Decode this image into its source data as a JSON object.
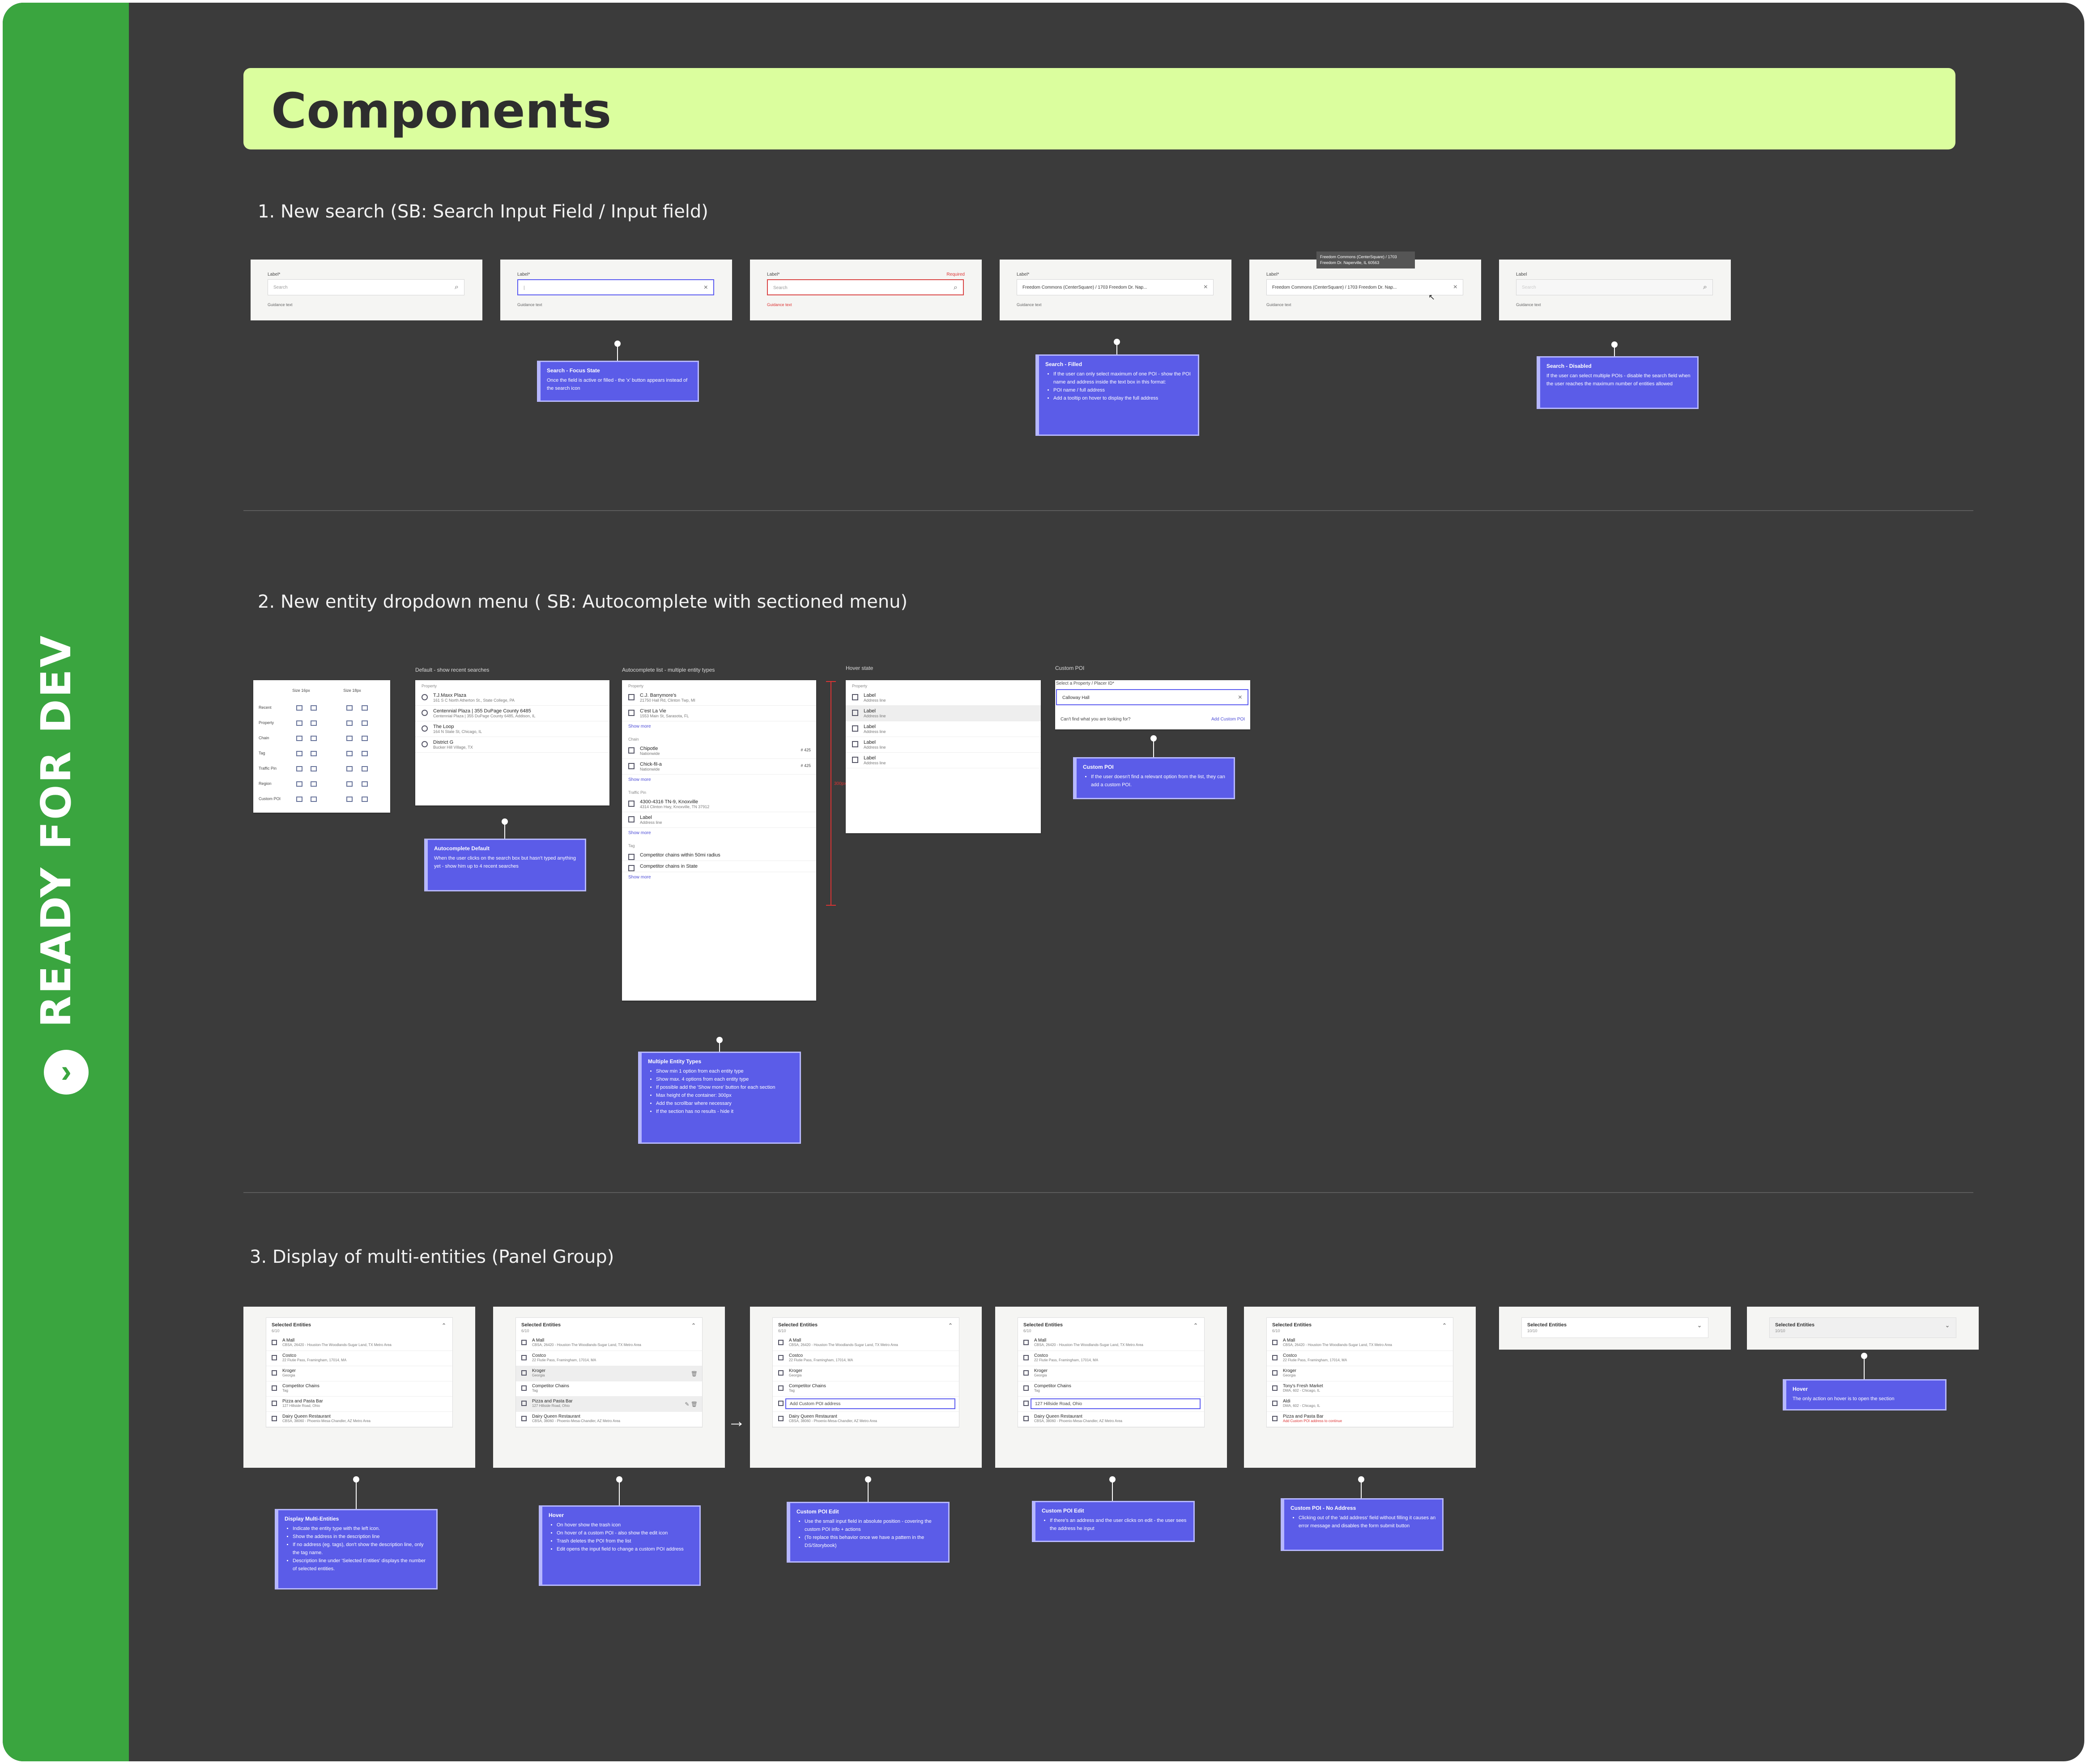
{
  "rail": {
    "label": "READY FOR DEV",
    "arrow": "›"
  },
  "header": {
    "title": "Components"
  },
  "s1": {
    "title": "1. New search (SB: Search Input Field / Input field)",
    "cards": [
      {
        "label": "Label*",
        "value": "Search",
        "guide": "Guidance text",
        "state": "default",
        "icon": "⌕"
      },
      {
        "label": "Label*",
        "value": "|",
        "guide": "Guidance text",
        "state": "focus",
        "icon": "×"
      },
      {
        "label": "Label*",
        "required": "Required",
        "value": "Search",
        "guide": "Guidance text",
        "state": "error",
        "icon": "⌕"
      },
      {
        "label": "Label*",
        "value": "Freedom Commons (CenterSquare) / 1703 Freedom Dr. Nap...",
        "guide": "Guidance text",
        "state": "filled",
        "icon": "×"
      },
      {
        "label": "Label*",
        "value": "Freedom Commons (CenterSquare) / 1703 Freedom Dr. Nap...",
        "guide": "Guidance text",
        "state": "filled",
        "icon": "×",
        "tooltip": "Freedom Commons (CenterSquare) / 1703 Freedom Dr. Naperville, IL 60563"
      },
      {
        "label": "Label",
        "value": "Search",
        "guide": "Guidance text",
        "state": "disabled",
        "icon": "⌕"
      }
    ],
    "notes": {
      "focus": {
        "title": "Search - Focus State",
        "body": "Once the field is active or filled - the 'x' button appears instead of the search icon"
      },
      "filled": {
        "title": "Search - Filled",
        "items": [
          "If the user can only select maximum of one POI - show the POI name and address inside the text box in this format:",
          "POI name / full address",
          "Add a tooltip on hover to display the full address"
        ]
      },
      "disabled": {
        "title": "Search - Disabled",
        "body": "If the user can select multiple POIs - disable the search field when the user reaches the maximum number of entities allowed"
      }
    }
  },
  "s2": {
    "title": "2. New entity dropdown menu ( SB: Autocomplete with sectioned menu)",
    "legend": {
      "heads": [
        "Size 16px",
        "Size 18px"
      ],
      "rows": [
        "Recent",
        "Property",
        "Chain",
        "Tag",
        "Traffic Pin",
        "Region",
        "Custom POI"
      ]
    },
    "recent": {
      "title": "Default - show recent searches",
      "group": "Property",
      "items": [
        {
          "name": "T.J.Maxx Plaza",
          "addr": "161 S C North Atherton St., State College, PA"
        },
        {
          "name": "Centennial Plaza | 355 DuPage County 6485",
          "addr": "Centennial Plaza | 355 DuPage County 6485, Addison, IL"
        },
        {
          "name": "The Loop",
          "addr": "164 N State St, Chicago, IL"
        },
        {
          "name": "District G",
          "addr": "Bucker Hill Village, TX"
        }
      ],
      "note": {
        "title": "Autocomplete Default",
        "body": "When the user clicks on the search box but hasn't typed anything yet - show him up to 4 recent searches"
      }
    },
    "multi": {
      "title": "Autocomplete list - multiple entity types",
      "groups": [
        {
          "name": "Property",
          "items": [
            {
              "name": "C.J. Barrymore's",
              "addr": "21750 Hall Rd, Clinton Twp, MI"
            },
            {
              "name": "C'est La Vie",
              "addr": "1553 Main St, Sarasota, FL"
            }
          ],
          "more": "Show more"
        },
        {
          "name": "Chain",
          "items": [
            {
              "name": "Chipotle",
              "addr": "Nationwide",
              "badge": "# 425"
            },
            {
              "name": "Chick-fil-a",
              "addr": "Nationwide",
              "badge": "# 425"
            }
          ],
          "more": "Show more"
        },
        {
          "name": "Traffic Pin",
          "items": [
            {
              "name": "4300-4316 TN-9, Knoxville",
              "addr": "4314 Clinton Hwy, Knoxville, TN 37912"
            },
            {
              "name": "Label",
              "addr": "Address line"
            }
          ],
          "more": "Show more"
        },
        {
          "name": "Tag",
          "items": [
            {
              "name": "Competitor chains within 50mi radius",
              "addr": ""
            },
            {
              "name": "Competitor chains in State",
              "addr": ""
            }
          ],
          "more": "Show more"
        }
      ],
      "height_label": "300px",
      "note": {
        "title": "Multiple Entity Types",
        "items": [
          "Show min 1 option from each entity type",
          "Show max. 4 options from each entity type",
          "If possible add the 'Show more' button for each section",
          "Max height of the container: 300px",
          "Add the scrollbar where necessary",
          "If the section has no results - hide it"
        ]
      }
    },
    "hover": {
      "title": "Hover state",
      "group": "Property",
      "items": [
        {
          "name": "Label",
          "addr": "Address line"
        },
        {
          "name": "Label",
          "addr": "Address line"
        },
        {
          "name": "Label",
          "addr": "Address line"
        },
        {
          "name": "Label",
          "addr": "Address line"
        },
        {
          "name": "Label",
          "addr": "Address line"
        }
      ]
    },
    "custom": {
      "title": "Custom POI",
      "label": "Select a Property / Placer ID*",
      "value": "Calloway Hall",
      "prompt": "Can't find what you are looking for?",
      "link": "Add Custom POI",
      "note": {
        "title": "Custom POI",
        "items": [
          "If the user doesn't find a relevant option from the list, they can add a custom POI."
        ]
      }
    }
  },
  "s3": {
    "title": "3. Display of multi-entities (Panel Group)",
    "header": "Selected Entities",
    "count": "6/10",
    "count_full": "10/10",
    "entities": [
      {
        "name": "A Mall",
        "addr": "CBSA, 26420 - Houston-The Woodlands-Sugar Land, TX Metro Area"
      },
      {
        "name": "Costco",
        "addr": "22 Flutie Pass, Framingham, 17014, MA"
      },
      {
        "name": "Kroger",
        "addr": "Georgia"
      },
      {
        "name": "Competitor Chains",
        "addr": "Tag"
      },
      {
        "name": "Pizza and Pasta Bar",
        "addr": "127 Hillside Road, Ohio"
      },
      {
        "name": "Dairy Queen Restaurant",
        "addr": "CBSA, 38060 - Phoenix-Mesa-Chandler, AZ Metro Area"
      }
    ],
    "entities_noaddr": [
      {
        "name": "A Mall",
        "addr": "CBSA, 26420 - Houston-The Woodlands-Sugar Land, TX Metro Area"
      },
      {
        "name": "Costco",
        "addr": "22 Flutie Pass, Framingham, 17014, MA"
      },
      {
        "name": "Kroger",
        "addr": "Georgia"
      },
      {
        "name": "Tony's Fresh Market",
        "addr": "DMA, 602 - Chicago, IL"
      },
      {
        "name": "Aldi",
        "addr": "DMA, 602 - Chicago, IL"
      },
      {
        "name": "Pizza and Pasta Bar",
        "addr": "Add Custom POI address to continue"
      }
    ],
    "edit_placeholder": "Add Custom POI address",
    "edit_value": "127 Hillside Road, Ohio",
    "arrow": "→",
    "notes": {
      "display": {
        "title": "Display Multi-Entities",
        "items": [
          "Indicate the entity type with the left icon.",
          "Show the address in the description line",
          "If no address (eg. tags), don't show the description line, only the tag name.",
          "Description line under 'Selected Entities' displays the number of selected entities."
        ]
      },
      "hover": {
        "title": "Hover",
        "items": [
          "On hover show the trash icon",
          "On hover of a custom POI - also show the edit icon",
          "Trash deletes the POI from the list",
          "Edit opens the input field to change a custom POI address"
        ]
      },
      "edit1": {
        "title": "Custom POI Edit",
        "items": [
          "Use the small input field in absolute position - covering the custom POI info + actions",
          "(To replace this behavior once we have a pattern in the DS/Storybook)"
        ]
      },
      "edit2": {
        "title": "Custom POI Edit",
        "items": [
          "If there's an address and the user clicks on edit - the user sees the address he input"
        ]
      },
      "noaddr": {
        "title": "Custom POI - No Address",
        "items": [
          "Clicking out of the 'add address' field without filling it causes an error message and disables the form submit button"
        ]
      },
      "collapsed": {
        "title": "Hover",
        "body": "The only action on hover is to open the section"
      }
    }
  }
}
